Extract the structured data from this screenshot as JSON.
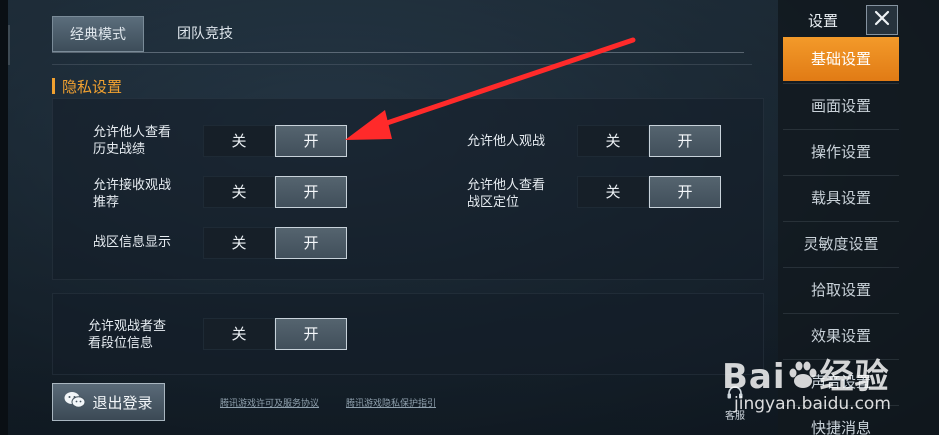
{
  "tabs": [
    {
      "label": "经典模式",
      "active": true
    },
    {
      "label": "团队竞技",
      "active": false
    }
  ],
  "section": {
    "title": "隐私设置"
  },
  "toggles": [
    {
      "label_l1": "允许他人查看",
      "label_l2": "历史战绩",
      "off": "关",
      "on": "开",
      "value": "on"
    },
    {
      "label_l1": "允许他人观战",
      "label_l2": "",
      "off": "关",
      "on": "开",
      "value": "on"
    },
    {
      "label_l1": "允许接收观战",
      "label_l2": "推荐",
      "off": "关",
      "on": "开",
      "value": "on"
    },
    {
      "label_l1": "允许他人查看",
      "label_l2": "战区定位",
      "off": "关",
      "on": "开",
      "value": "on"
    },
    {
      "label_l1": "战区信息显示",
      "label_l2": "",
      "off": "关",
      "on": "开",
      "value": "on"
    },
    {
      "label_l1": "允许观战者查",
      "label_l2": "看段位信息",
      "off": "关",
      "on": "开",
      "value": "on"
    }
  ],
  "footer": {
    "logout": "退出登录",
    "link1": "腾讯游戏许可及服务协议",
    "link2": "腾讯游戏隐私保护指引",
    "service": "客服"
  },
  "sidebar": {
    "title": "设置",
    "items": [
      {
        "label": "基础设置",
        "active": true
      },
      {
        "label": "画面设置"
      },
      {
        "label": "操作设置"
      },
      {
        "label": "载具设置"
      },
      {
        "label": "灵敏度设置"
      },
      {
        "label": "拾取设置"
      },
      {
        "label": "效果设置"
      },
      {
        "label": "声音设置"
      },
      {
        "label": "快捷消息"
      }
    ]
  },
  "watermark": {
    "brand": "Bai",
    "brand_cn": "经验",
    "url": "jingyan.baidu.com"
  },
  "colors": {
    "accent": "#f0a030",
    "sidebar_active": "#ef8f22",
    "annotation_arrow": "#ff2a2a"
  }
}
